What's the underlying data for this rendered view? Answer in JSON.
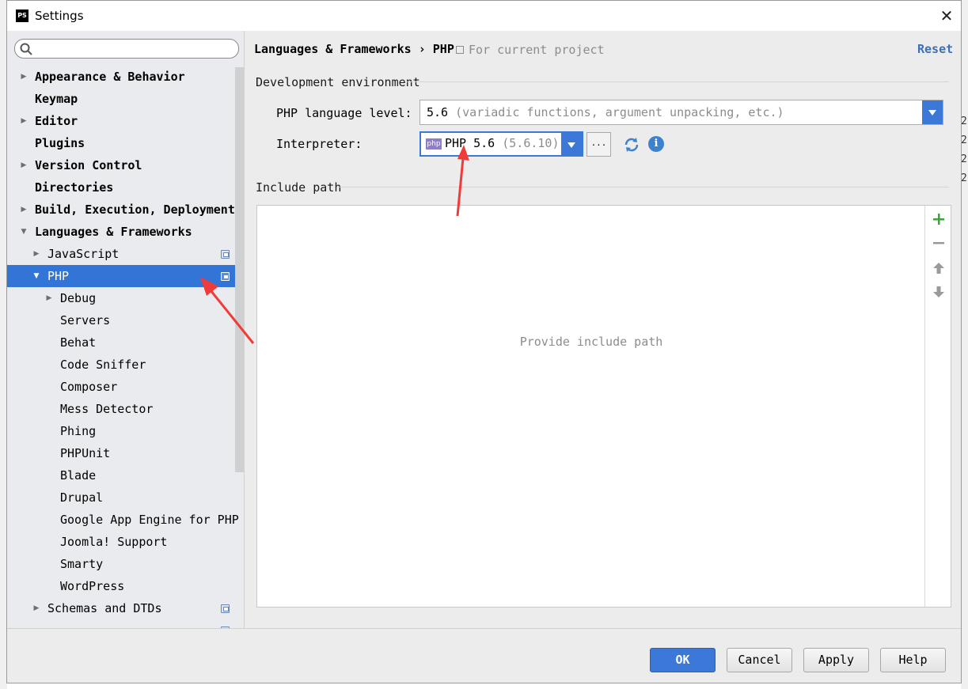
{
  "window": {
    "title": "Settings",
    "app_icon": "PS",
    "close_glyph": "✕"
  },
  "search": {
    "placeholder": ""
  },
  "tree": [
    {
      "label": "Appearance & Behavior",
      "bold": true,
      "arrow": "▶",
      "level": 0
    },
    {
      "label": "Keymap",
      "bold": true,
      "arrow": "",
      "level": 0
    },
    {
      "label": "Editor",
      "bold": true,
      "arrow": "▶",
      "level": 0
    },
    {
      "label": "Plugins",
      "bold": true,
      "arrow": "",
      "level": 0
    },
    {
      "label": "Version Control",
      "bold": true,
      "arrow": "▶",
      "level": 0
    },
    {
      "label": "Directories",
      "bold": true,
      "arrow": "",
      "level": 0
    },
    {
      "label": "Build, Execution, Deployment",
      "bold": true,
      "arrow": "▶",
      "level": 0
    },
    {
      "label": "Languages & Frameworks",
      "bold": true,
      "arrow": "▼",
      "level": 0
    },
    {
      "label": "JavaScript",
      "bold": false,
      "arrow": "▶",
      "level": 1,
      "project": true
    },
    {
      "label": "PHP",
      "bold": false,
      "arrow": "▼",
      "level": 1,
      "project": true,
      "selected": true
    },
    {
      "label": "Debug",
      "bold": false,
      "arrow": "▶",
      "level": 2
    },
    {
      "label": "Servers",
      "bold": false,
      "arrow": "",
      "level": 2
    },
    {
      "label": "Behat",
      "bold": false,
      "arrow": "",
      "level": 2
    },
    {
      "label": "Code Sniffer",
      "bold": false,
      "arrow": "",
      "level": 2
    },
    {
      "label": "Composer",
      "bold": false,
      "arrow": "",
      "level": 2
    },
    {
      "label": "Mess Detector",
      "bold": false,
      "arrow": "",
      "level": 2
    },
    {
      "label": "Phing",
      "bold": false,
      "arrow": "",
      "level": 2
    },
    {
      "label": "PHPUnit",
      "bold": false,
      "arrow": "",
      "level": 2
    },
    {
      "label": "Blade",
      "bold": false,
      "arrow": "",
      "level": 2
    },
    {
      "label": "Drupal",
      "bold": false,
      "arrow": "",
      "level": 2
    },
    {
      "label": "Google App Engine for PHP",
      "bold": false,
      "arrow": "",
      "level": 2
    },
    {
      "label": "Joomla! Support",
      "bold": false,
      "arrow": "",
      "level": 2
    },
    {
      "label": "Smarty",
      "bold": false,
      "arrow": "",
      "level": 2
    },
    {
      "label": "WordPress",
      "bold": false,
      "arrow": "",
      "level": 2
    },
    {
      "label": "Schemas and DTDs",
      "bold": false,
      "arrow": "▶",
      "level": 1,
      "project": true
    },
    {
      "label": "",
      "bold": false,
      "arrow": "",
      "level": 1,
      "project": true
    }
  ],
  "breadcrumb": {
    "parent": "Languages & Frameworks",
    "separator": "›",
    "current": "PHP",
    "scope": "For current project"
  },
  "reset_label": "Reset",
  "dev_env": {
    "section": "Development environment",
    "language_level_label": "PHP language level:",
    "language_level_value": "5.6",
    "language_level_desc": "(variadic functions, argument unpacking, etc.)",
    "interpreter_label": "Interpreter:",
    "interpreter_badge": "php",
    "interpreter_name": "PHP 5.6",
    "interpreter_version": "(5.6.10)",
    "browse_label": "..."
  },
  "include": {
    "section": "Include path",
    "empty_text": "Provide include path"
  },
  "buttons": {
    "ok": "OK",
    "cancel": "Cancel",
    "apply": "Apply",
    "help": "Help"
  },
  "background_fragments": [
    "2",
    "2",
    "2",
    "2"
  ],
  "colors": {
    "accent": "#3b78d8",
    "annotation": "#f03b3b",
    "selection": "#3375d6"
  }
}
